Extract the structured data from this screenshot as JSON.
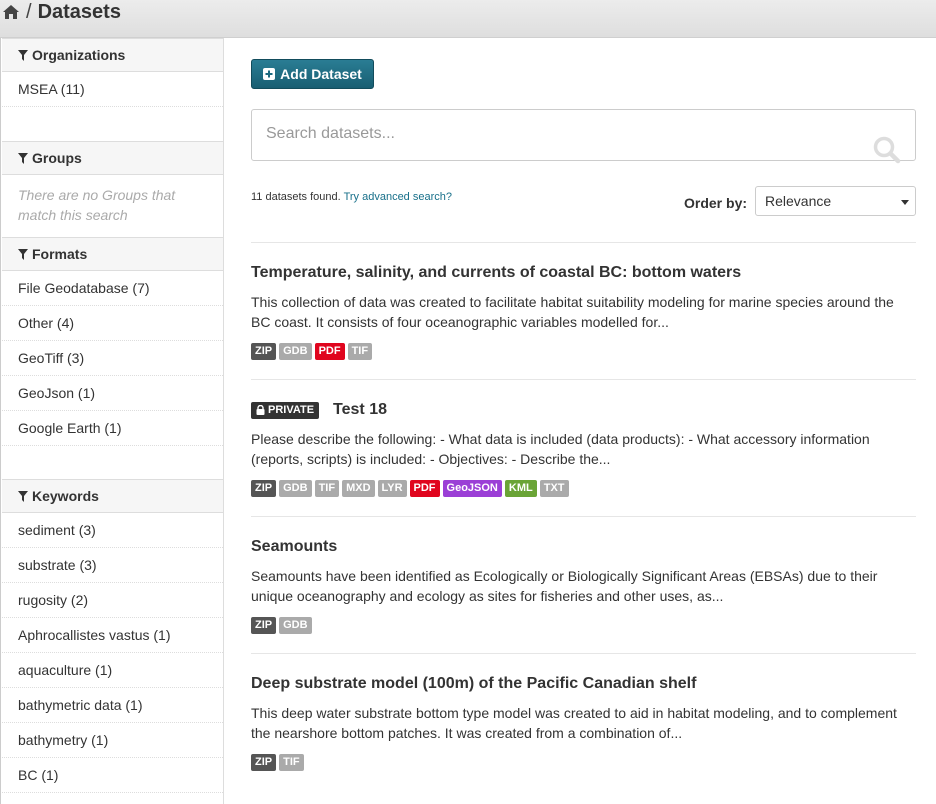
{
  "breadcrumb": {
    "separator": "/",
    "current": "Datasets"
  },
  "sidebar": {
    "organizations": {
      "title": "Organizations",
      "items": [
        "MSEA (11)"
      ]
    },
    "groups": {
      "title": "Groups",
      "empty": "There are no Groups that match this search"
    },
    "formats": {
      "title": "Formats",
      "items": [
        "File Geodatabase (7)",
        "Other (4)",
        "GeoTiff (3)",
        "GeoJson (1)",
        "Google Earth (1)"
      ]
    },
    "keywords": {
      "title": "Keywords",
      "items": [
        "sediment (3)",
        "substrate (3)",
        "rugosity (2)",
        "Aphrocallistes vastus (1)",
        "aquaculture (1)",
        "bathymetric data (1)",
        "bathymetry (1)",
        "BC (1)"
      ]
    }
  },
  "main": {
    "add_button": "Add Dataset",
    "search_placeholder": "Search datasets...",
    "results_count": "11 datasets found.",
    "advanced_link": "Try advanced search?",
    "order_label": "Order by:",
    "order_value": "Relevance"
  },
  "datasets": [
    {
      "title": "Temperature, salinity, and currents of coastal BC: bottom waters",
      "private": false,
      "description": "This collection of data was created to facilitate habitat suitability modeling for marine species around the BC coast. It consists of four oceanographic variables modelled for...",
      "formats": [
        {
          "label": "ZIP",
          "color": "#555555"
        },
        {
          "label": "GDB",
          "color": "#aaaaaa"
        },
        {
          "label": "PDF",
          "color": "#e0051e"
        },
        {
          "label": "TIF",
          "color": "#aaaaaa"
        }
      ]
    },
    {
      "title": "Test 18",
      "private": true,
      "private_label": "PRIVATE",
      "description": "Please describe the following: - What data is included (data products): - What accessory information (reports, scripts) is included: - Objectives: - Describe the...",
      "formats": [
        {
          "label": "ZIP",
          "color": "#555555"
        },
        {
          "label": "GDB",
          "color": "#aaaaaa"
        },
        {
          "label": "TIF",
          "color": "#aaaaaa"
        },
        {
          "label": "MXD",
          "color": "#aaaaaa"
        },
        {
          "label": "LYR",
          "color": "#aaaaaa"
        },
        {
          "label": "PDF",
          "color": "#e0051e"
        },
        {
          "label": "GeoJSON",
          "color": "#9b3fd6"
        },
        {
          "label": "KML",
          "color": "#6aa436"
        },
        {
          "label": "TXT",
          "color": "#aaaaaa"
        }
      ]
    },
    {
      "title": "Seamounts",
      "private": false,
      "description": "Seamounts have been identified as Ecologically or Biologically Significant Areas (EBSAs) due to their unique oceanography and ecology as sites for fisheries and other uses, as...",
      "formats": [
        {
          "label": "ZIP",
          "color": "#555555"
        },
        {
          "label": "GDB",
          "color": "#aaaaaa"
        }
      ]
    },
    {
      "title": "Deep substrate model (100m) of the Pacific Canadian shelf",
      "private": false,
      "description": "This deep water substrate bottom type model was created to aid in habitat modeling, and to complement the nearshore bottom patches. It was created from a combination of...",
      "formats": [
        {
          "label": "ZIP",
          "color": "#555555"
        },
        {
          "label": "TIF",
          "color": "#aaaaaa"
        }
      ]
    }
  ]
}
